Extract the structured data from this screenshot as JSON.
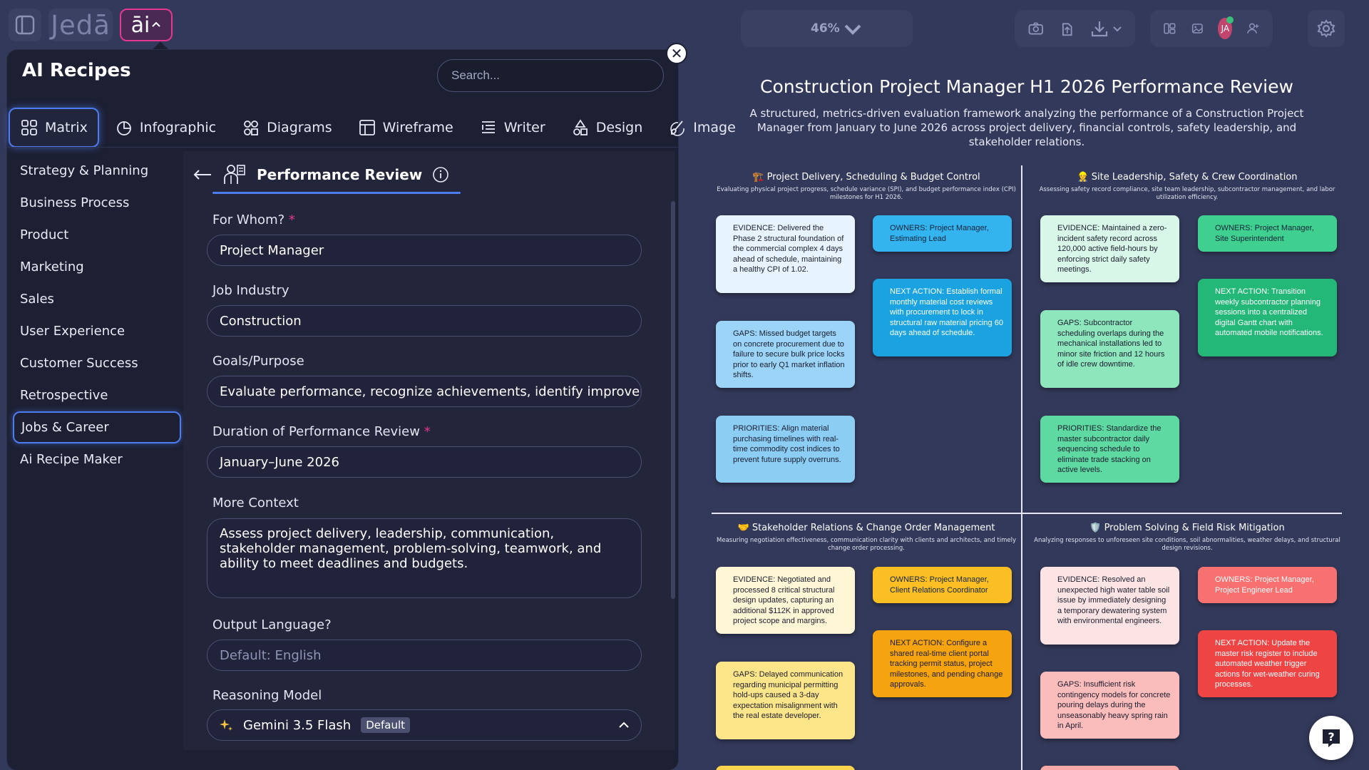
{
  "app": {
    "logo": "Jedā",
    "ai_label": "āi"
  },
  "toolbar": {
    "zoom": "46%"
  },
  "user": {
    "initials": "JA"
  },
  "panel": {
    "title": "AI Recipes",
    "search_placeholder": "Search...",
    "tabs": [
      {
        "label": "Matrix",
        "icon": "grid-icon"
      },
      {
        "label": "Infographic",
        "icon": "pie-chart-icon"
      },
      {
        "label": "Diagrams",
        "icon": "diagram-icon"
      },
      {
        "label": "Wireframe",
        "icon": "wireframe-icon"
      },
      {
        "label": "Writer",
        "icon": "writer-icon"
      },
      {
        "label": "Design",
        "icon": "shapes-icon"
      },
      {
        "label": "Image",
        "icon": "brush-icon"
      }
    ],
    "categories": [
      "Strategy & Planning",
      "Business Process",
      "Product",
      "Marketing",
      "Sales",
      "User Experience",
      "Customer Success",
      "Retrospective",
      "Jobs & Career",
      "Ai Recipe Maker"
    ],
    "active_category": "Jobs & Career"
  },
  "recipe": {
    "title": "Performance Review",
    "fields": {
      "for_whom": {
        "label": "For Whom?",
        "value": "Project Manager",
        "required": "*"
      },
      "industry": {
        "label": "Job Industry",
        "value": "Construction"
      },
      "goals": {
        "label": "Goals/Purpose",
        "value": "Evaluate performance, recognize achievements, identify improvement"
      },
      "duration": {
        "label": "Duration of Performance Review",
        "value": "January–June 2026",
        "required": "*"
      },
      "context": {
        "label": "More Context",
        "value": "Assess project delivery, leadership, communication, stakeholder management, problem-solving, teamwork, and ability to meet deadlines and budgets."
      },
      "language": {
        "label": "Output Language?",
        "placeholder": "Default: English"
      },
      "model": {
        "label": "Reasoning Model",
        "value": "Gemini 3.5 Flash",
        "badge": "Default"
      }
    }
  },
  "document": {
    "title": "Construction Project Manager H1 2026 Performance Review",
    "subtitle": "A structured, metrics-driven evaluation framework analyzing the performance of a Construction Project Manager from January to June 2026 across project delivery, financial controls, safety leadership, and stakeholder relations.",
    "quadrants": [
      {
        "title": "🏗️ Project Delivery, Scheduling & Budget Control",
        "desc": "Evaluating physical project progress, schedule variance (SPI), and budget performance index (CPI) milestones for H1 2026.",
        "colors": {
          "light": "#e8f4fd",
          "mid": "#9bd4f6",
          "strong": "#34b4ee",
          "deep": "#1aa3e0"
        },
        "notes": {
          "evidence": "EVIDENCE: Delivered the Phase 2 structural foundation of the commercial complex 4 days ahead of schedule, maintaining a healthy CPI of 1.02.",
          "gaps": "GAPS: Missed budget targets on concrete procurement due to failure to secure bulk price locks prior to early Q1 market inflation shifts.",
          "priorities": "PRIORITIES: Align material purchasing timelines with real-time commodity cost indices to prevent future supply overruns.",
          "owners": "OWNERS: Project Manager, Estimating Lead",
          "next": "NEXT ACTION: Establish formal monthly material cost reviews with procurement to lock in structural raw material pricing 60 days ahead of schedule."
        }
      },
      {
        "title": "👷 Site Leadership, Safety & Crew Coordination",
        "desc": "Assessing safety record compliance, site team leadership, subcontractor management, and labor utilization efficiency.",
        "colors": {
          "light": "#d9f7e8",
          "mid": "#8ee6bd",
          "strong": "#3fd08f",
          "deep": "#23b877"
        },
        "notes": {
          "evidence": "EVIDENCE: Maintained a zero-incident safety record across 120,000 active field-hours by enforcing strict daily safety meetings.",
          "gaps": "GAPS: Subcontractor scheduling overlaps during the mechanical installations led to minor site friction and 12 hours of idle crew downtime.",
          "priorities": "PRIORITIES: Standardize the master subcontractor daily sequencing schedule to eliminate trade stacking on active levels.",
          "owners": "OWNERS: Project Manager, Site Superintendent",
          "next": "NEXT ACTION: Transition weekly subcontractor planning sessions into a centralized digital Gantt chart with automated mobile notifications."
        }
      },
      {
        "title": "🤝 Stakeholder Relations & Change Order Management",
        "desc": "Measuring negotiation effectiveness, communication clarity with clients and architects, and timely change order processing.",
        "colors": {
          "light": "#fff6d6",
          "mid": "#fde68a",
          "strong": "#fbbf24",
          "deep": "#f5a30f"
        },
        "notes": {
          "evidence": "EVIDENCE: Negotiated and processed 8 critical structural design updates, capturing an additional $112K in approved project scope and margins.",
          "gaps": "GAPS: Delayed communication regarding municipal permitting hold-ups caused a 3-day expectation misalignment with the real estate developer.",
          "owners": "OWNERS: Project Manager, Client Relations Coordinator",
          "next": "NEXT ACTION: Configure a shared real-time client portal tracking permit status, project milestones, and pending change approvals."
        }
      },
      {
        "title": "🛡️ Problem Solving & Field Risk Mitigation",
        "desc": "Analyzing responses to unforeseen site conditions, soil abnormalities, weather delays, and structural design revisions.",
        "colors": {
          "light": "#fde4e4",
          "mid": "#fbbcbc",
          "strong": "#f87171",
          "deep": "#ef4444"
        },
        "notes": {
          "evidence": "EVIDENCE: Resolved an unexpected high water table soil issue by immediately designing a temporary dewatering system with environmental engineers.",
          "gaps": "GAPS: Insufficient risk contingency models for concrete pouring delays during the unseasonably heavy spring rain in April.",
          "owners": "OWNERS: Project Manager, Project Engineer Lead",
          "next": "NEXT ACTION: Update the master risk register to include automated weather trigger actions for wet-weather curing processes."
        }
      }
    ]
  }
}
